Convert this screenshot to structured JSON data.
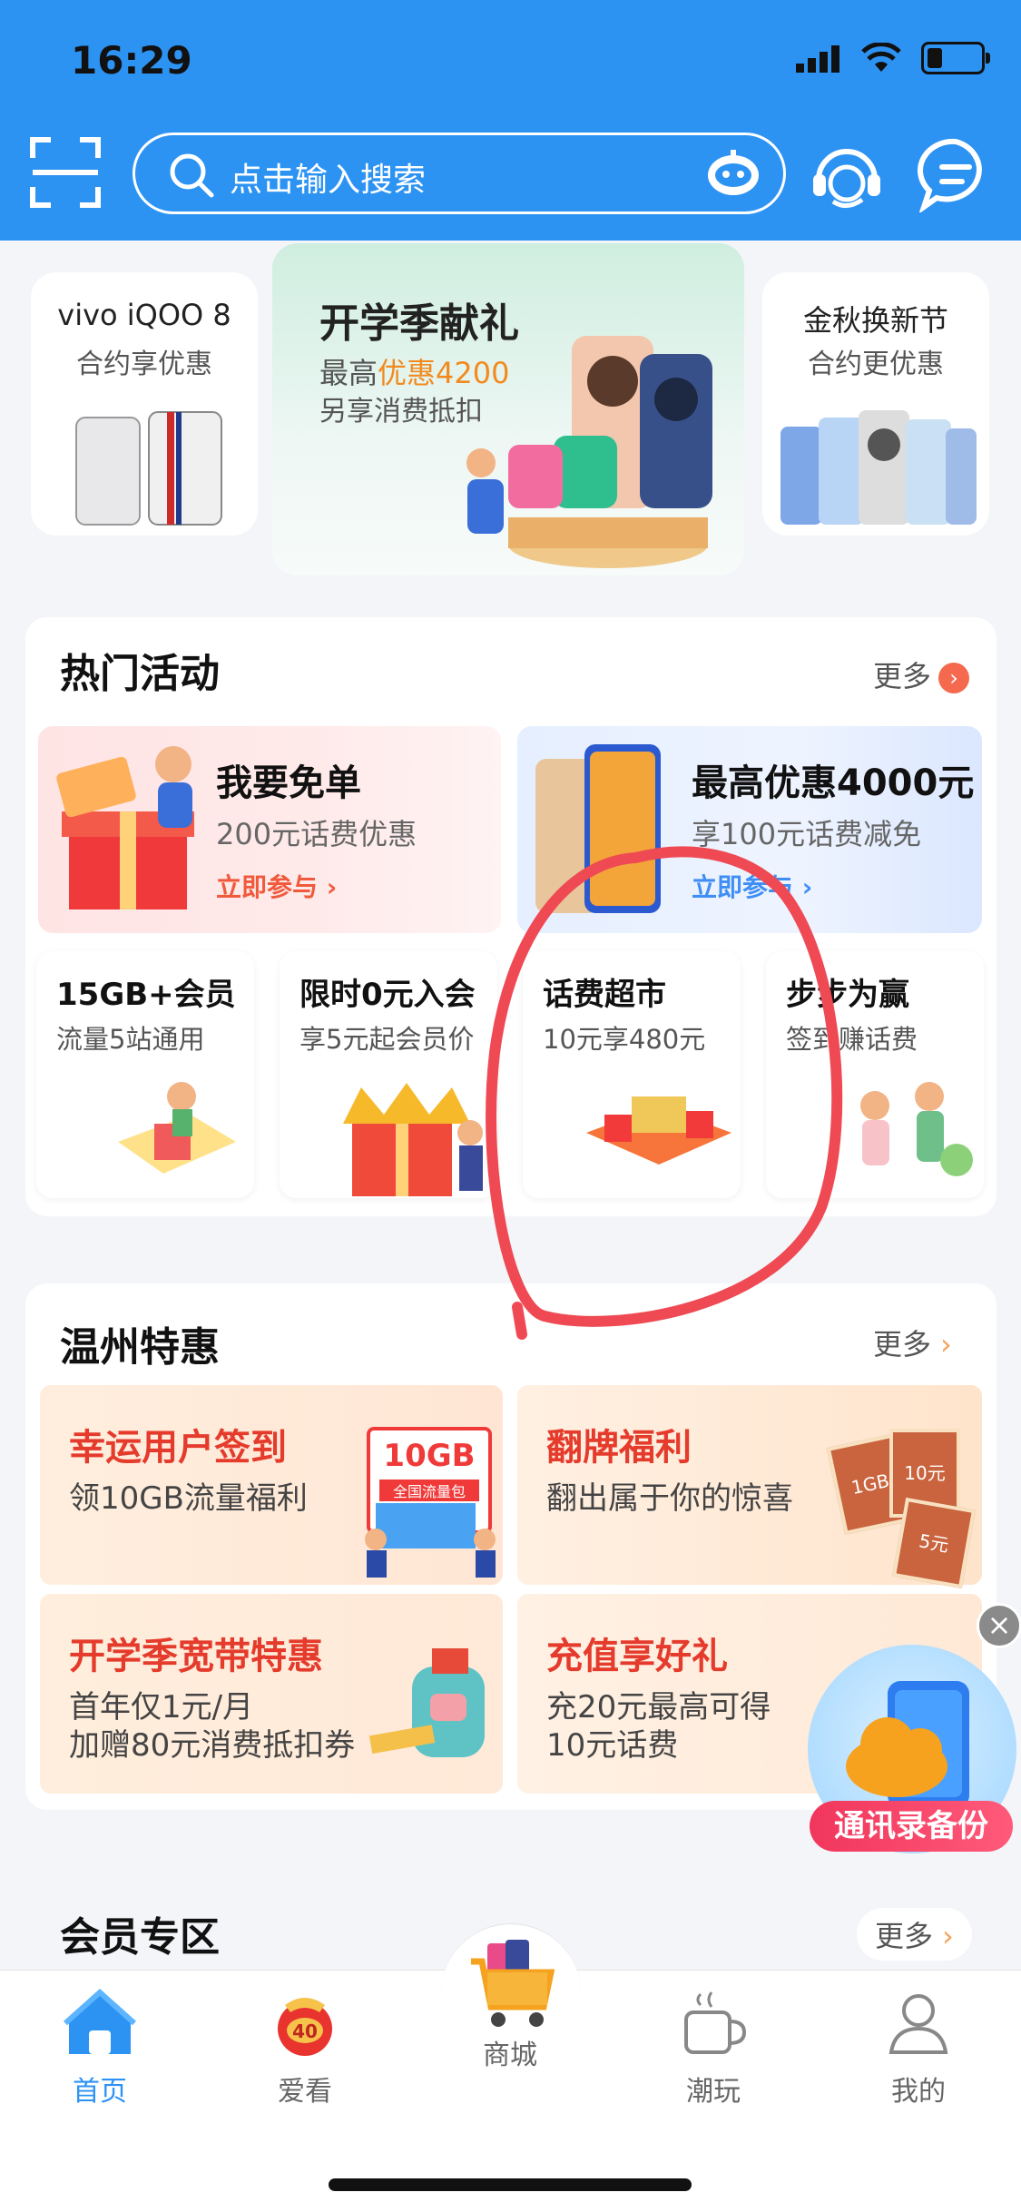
{
  "status_bar": {
    "time": "16:29"
  },
  "header": {
    "search_placeholder": "点击输入搜索"
  },
  "banners": {
    "left": {
      "title": "vivo iQOO 8",
      "subtitle": "合约享优惠"
    },
    "center": {
      "title": "开学季献礼",
      "line1_prefix": "最高",
      "line1_highlight": "优惠4200",
      "line2": "另享消费抵扣"
    },
    "right": {
      "title": "金秋换新节",
      "subtitle": "合约更优惠"
    }
  },
  "hot": {
    "title": "热门活动",
    "more": "更多",
    "big_cards": [
      {
        "title": "我要免单",
        "subtitle": "200元话费优惠",
        "action": "立即参与 ›"
      },
      {
        "title": "最高优惠4000元",
        "subtitle": "享100元话费减免",
        "action": "立即参与 ›"
      }
    ],
    "small_cards": [
      {
        "title": "15GB+会员",
        "subtitle": "流量5站通用"
      },
      {
        "title": "限时0元入会",
        "subtitle": "享5元起会员价"
      },
      {
        "title": "话费超市",
        "subtitle": "10元享480元"
      },
      {
        "title": "步步为赢",
        "subtitle": "签到赚话费"
      }
    ]
  },
  "wenzhou": {
    "title": "温州特惠",
    "more": "更多",
    "deals": [
      {
        "title": "幸运用户签到",
        "subtitle": "领10GB流量福利",
        "badge": "10GB",
        "badge_sub": "全国流量包"
      },
      {
        "title": "翻牌福利",
        "subtitle": "翻出属于你的惊喜",
        "card_labels": [
          "10元",
          "1GB",
          "5元"
        ]
      },
      {
        "title": "开学季宽带特惠",
        "line1": "首年仅1元/月",
        "line2": "加赠80元消费抵扣券"
      },
      {
        "title": "充值享好礼",
        "line1": "充20元最高可得",
        "line2": "10元话费"
      }
    ]
  },
  "floating": {
    "label": "通讯录备份"
  },
  "member": {
    "title": "会员专区",
    "more": "更多"
  },
  "nav": {
    "items": [
      {
        "label": "首页",
        "active": true
      },
      {
        "label": "爱看",
        "badge": "40"
      },
      {
        "label": "商城"
      },
      {
        "label": "潮玩"
      },
      {
        "label": "我的"
      }
    ]
  },
  "colors": {
    "primary": "#2d93f3",
    "accent_red": "#e53b2c",
    "orange": "#f56a4f",
    "annotation": "#ef4a54"
  }
}
